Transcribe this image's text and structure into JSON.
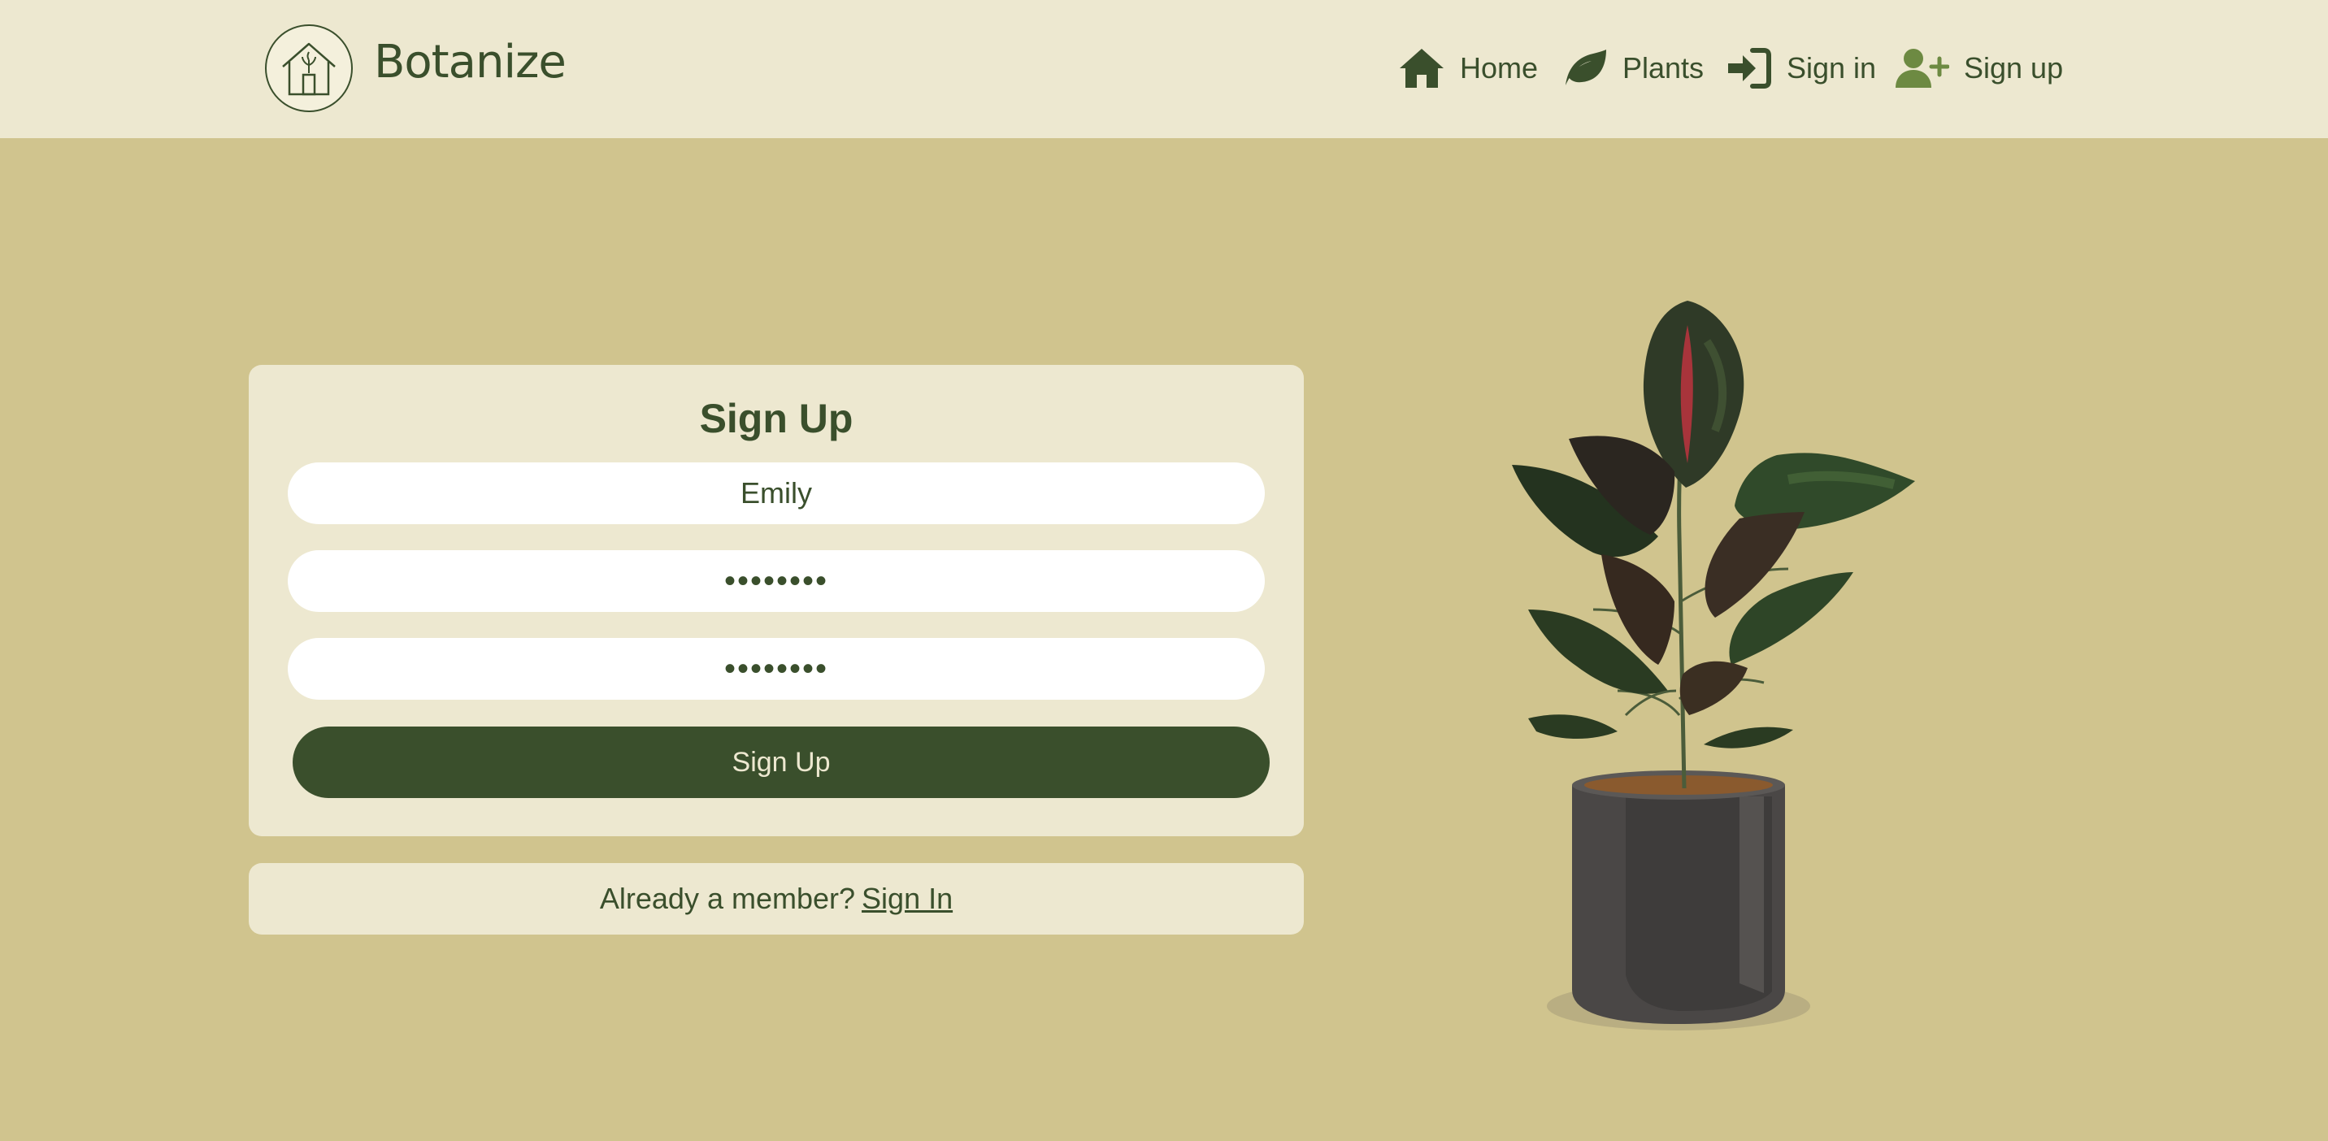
{
  "header": {
    "brand": "Botanize",
    "nav": [
      {
        "label": "Home",
        "icon": "home-icon"
      },
      {
        "label": "Plants",
        "icon": "leaf-icon"
      },
      {
        "label": "Sign in",
        "icon": "sign-in-icon"
      },
      {
        "label": "Sign up",
        "icon": "user-plus-icon"
      }
    ]
  },
  "form": {
    "title": "Sign Up",
    "username_value": "Emily",
    "password_value": "••••••••",
    "confirm_value": "••••••••",
    "submit_label": "Sign Up"
  },
  "footer_box": {
    "prompt": "Already a member?",
    "link": "Sign In"
  },
  "colors": {
    "background": "#d0c48e",
    "surface": "#ede8d0",
    "primary": "#3a4f2c"
  }
}
